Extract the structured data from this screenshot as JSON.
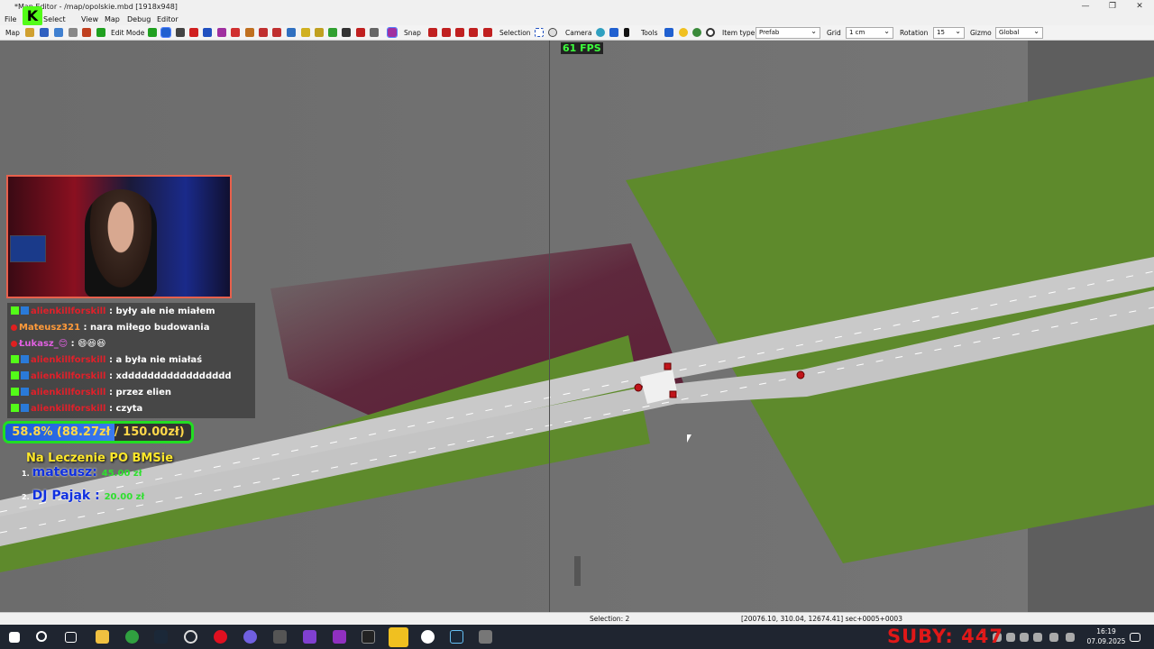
{
  "window": {
    "title": "*Map Editor - /map/opolskie.mbd [1918x948]"
  },
  "menu": [
    "File",
    "Select",
    "View",
    "Map",
    "Debug",
    "Editor"
  ],
  "toolbar": {
    "map_label": "Map",
    "edit_mode_label": "Edit Mode",
    "snap_label": "Snap",
    "selection_label": "Selection",
    "camera_label": "Camera",
    "tools_label": "Tools",
    "item_type_label": "Item type",
    "item_type_value": "Prefab",
    "grid_label": "Grid",
    "grid_value": "1 cm",
    "rotation_label": "Rotation",
    "rotation_value": "15",
    "gizmo_label": "Gizmo",
    "gizmo_value": "Global"
  },
  "viewport": {
    "fps": "61 FPS"
  },
  "chat": [
    {
      "user": "alienkillforskill",
      "message": ": były ale nie miałem",
      "user_color": "#e0202a",
      "badge": "kick"
    },
    {
      "user": "Mateusz321",
      "message": ": nara miłego budowania",
      "user_color": "#ff9a3a",
      "badge": "yt"
    },
    {
      "user": "Łukasz_😊",
      "message": ": 😄😆😆",
      "user_color": "#e060e0",
      "badge": "yt"
    },
    {
      "user": "alienkillforskill",
      "message": ": a była nie miałaś",
      "user_color": "#e0202a",
      "badge": "kick"
    },
    {
      "user": "alienkillforskill",
      "message": ": xddddddddddddddddd",
      "user_color": "#e0202a",
      "badge": "kick"
    },
    {
      "user": "alienkillforskill",
      "message": ": przez elien",
      "user_color": "#e0202a",
      "badge": "kick"
    },
    {
      "user": "alienkillforskill",
      "message": ": czyta",
      "user_color": "#e0202a",
      "badge": "kick"
    }
  ],
  "goal": {
    "text": "58.8% (88.27zł / 150.00zł)",
    "progress": 0.588,
    "subtitle": "Na Leczenie PO BMSie"
  },
  "donors": [
    {
      "rank": "1.",
      "name": "mateusz:",
      "amount": "45.00 zł"
    },
    {
      "rank": "2.",
      "name": "DJ Pająk :",
      "amount": "20.00 zł"
    }
  ],
  "statusbar": {
    "selection": "Selection: 2",
    "coords": "[20076.10, 310.04, 12674.41] sec+0005+0003"
  },
  "overlay": {
    "subs": "SUBY: 447"
  },
  "clock": {
    "time": "16:19",
    "date": "07.09.2025"
  },
  "colors": {
    "grass": "#5e8a2c",
    "road": "#c9c9c9",
    "ground": "#707070",
    "marker": "#c0141a"
  }
}
